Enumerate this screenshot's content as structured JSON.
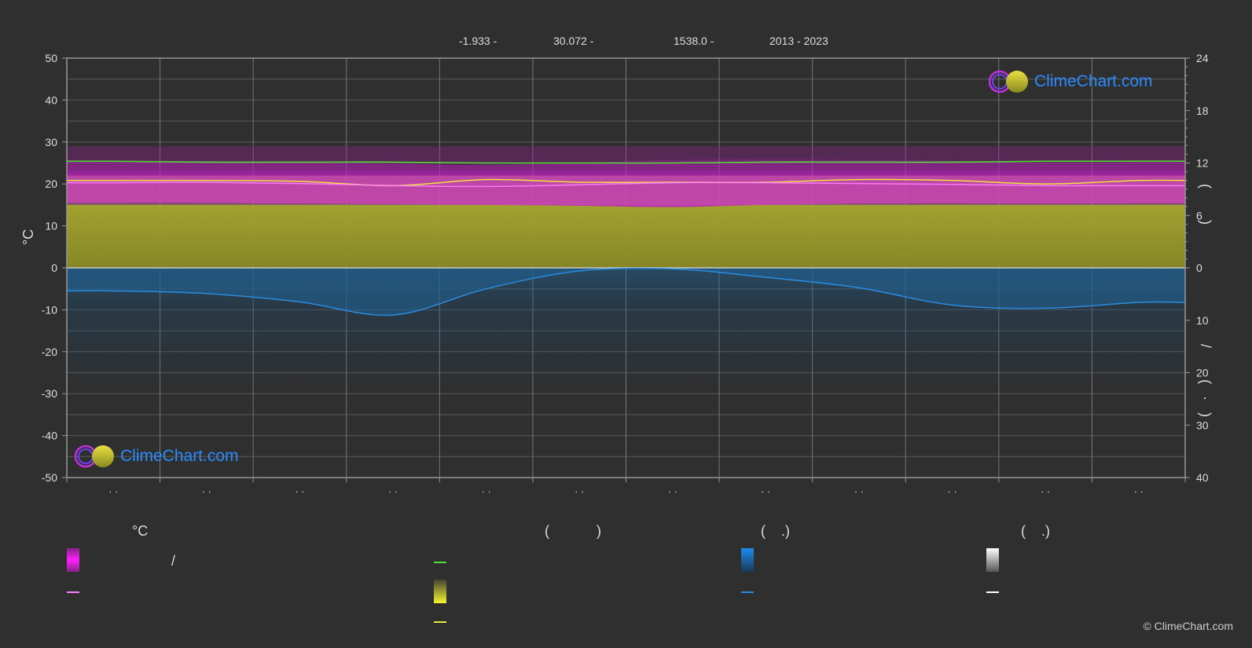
{
  "header": {
    "latitude": "-1.933 -",
    "longitude": "30.072 -",
    "elevation": "1538.0 -",
    "years": "2013 - 2023"
  },
  "axes": {
    "left_title": "°C",
    "right_title_top": "(        )",
    "right_title_bottom": "/        (   ·   )"
  },
  "legend": {
    "col1_head": "°C",
    "col1_sub": "/",
    "col2_head": "(            )",
    "col3_head": "(    .)",
    "col4_head": "(    .)"
  },
  "brand": {
    "name": "ClimeChart.com",
    "copyright": "© ClimeChart.com"
  },
  "colors": {
    "background": "#2f2f2f",
    "temp_range": "#c020c0",
    "temp_mean_band": "#e070b0",
    "sunshine": "#9a9a2a",
    "precip": "#1f5f8f",
    "daylight_line": "#55dd33",
    "sunshine_line": "#f0e040",
    "temp_line": "#ff80ff",
    "precip_line": "#2a8ce0",
    "brand_blue": "#2a8cff"
  },
  "chart_data": {
    "type": "area",
    "months": [
      "· ·",
      "· ·",
      "· ·",
      "· ·",
      "· ·",
      "· ·",
      "· ·",
      "· ·",
      "· ·",
      "· ·",
      "· ·",
      "· ·"
    ],
    "left_axis": {
      "ticks": [
        50,
        40,
        30,
        20,
        10,
        0,
        -10,
        -20,
        -30,
        -40,
        -50
      ],
      "ylim": [
        -50,
        50
      ],
      "unit": "°C"
    },
    "right_axis": {
      "top_ticks": [
        24,
        18,
        12,
        6,
        0
      ],
      "top_range": [
        0,
        24
      ],
      "bottom_ticks": [
        10,
        20,
        30,
        40
      ],
      "bottom_range": [
        0,
        40
      ]
    },
    "series": [
      {
        "key": "daylight_hours",
        "axis": "right_top",
        "values": [
          12.2,
          12.1,
          12.1,
          12.1,
          12.0,
          12.0,
          12.0,
          12.1,
          12.1,
          12.1,
          12.2,
          12.2
        ]
      },
      {
        "key": "sunshine_hours",
        "axis": "right_top",
        "values": [
          10.0,
          10.0,
          9.9,
          9.4,
          10.1,
          9.8,
          9.8,
          9.8,
          10.1,
          10.0,
          9.6,
          10.0
        ]
      },
      {
        "key": "temp_mean",
        "axis": "left",
        "values": [
          20.3,
          20.4,
          20.1,
          19.6,
          19.4,
          19.8,
          20.3,
          20.3,
          20.1,
          19.9,
          19.6,
          19.6
        ]
      },
      {
        "key": "temp_max",
        "axis": "left",
        "values": [
          25.5,
          25.5,
          25.2,
          24.8,
          24.5,
          25.0,
          25.8,
          26.0,
          25.8,
          25.5,
          25.0,
          25.2
        ]
      },
      {
        "key": "temp_min",
        "axis": "left",
        "values": [
          15.5,
          15.5,
          15.3,
          15.2,
          15.0,
          14.8,
          14.5,
          15.0,
          15.3,
          15.4,
          15.3,
          15.4
        ]
      },
      {
        "key": "precip_mean",
        "axis": "right_bottom",
        "values": [
          4.4,
          4.9,
          6.5,
          9.0,
          4.0,
          0.6,
          0.2,
          1.8,
          3.8,
          7.1,
          7.7,
          6.6
        ]
      }
    ]
  }
}
